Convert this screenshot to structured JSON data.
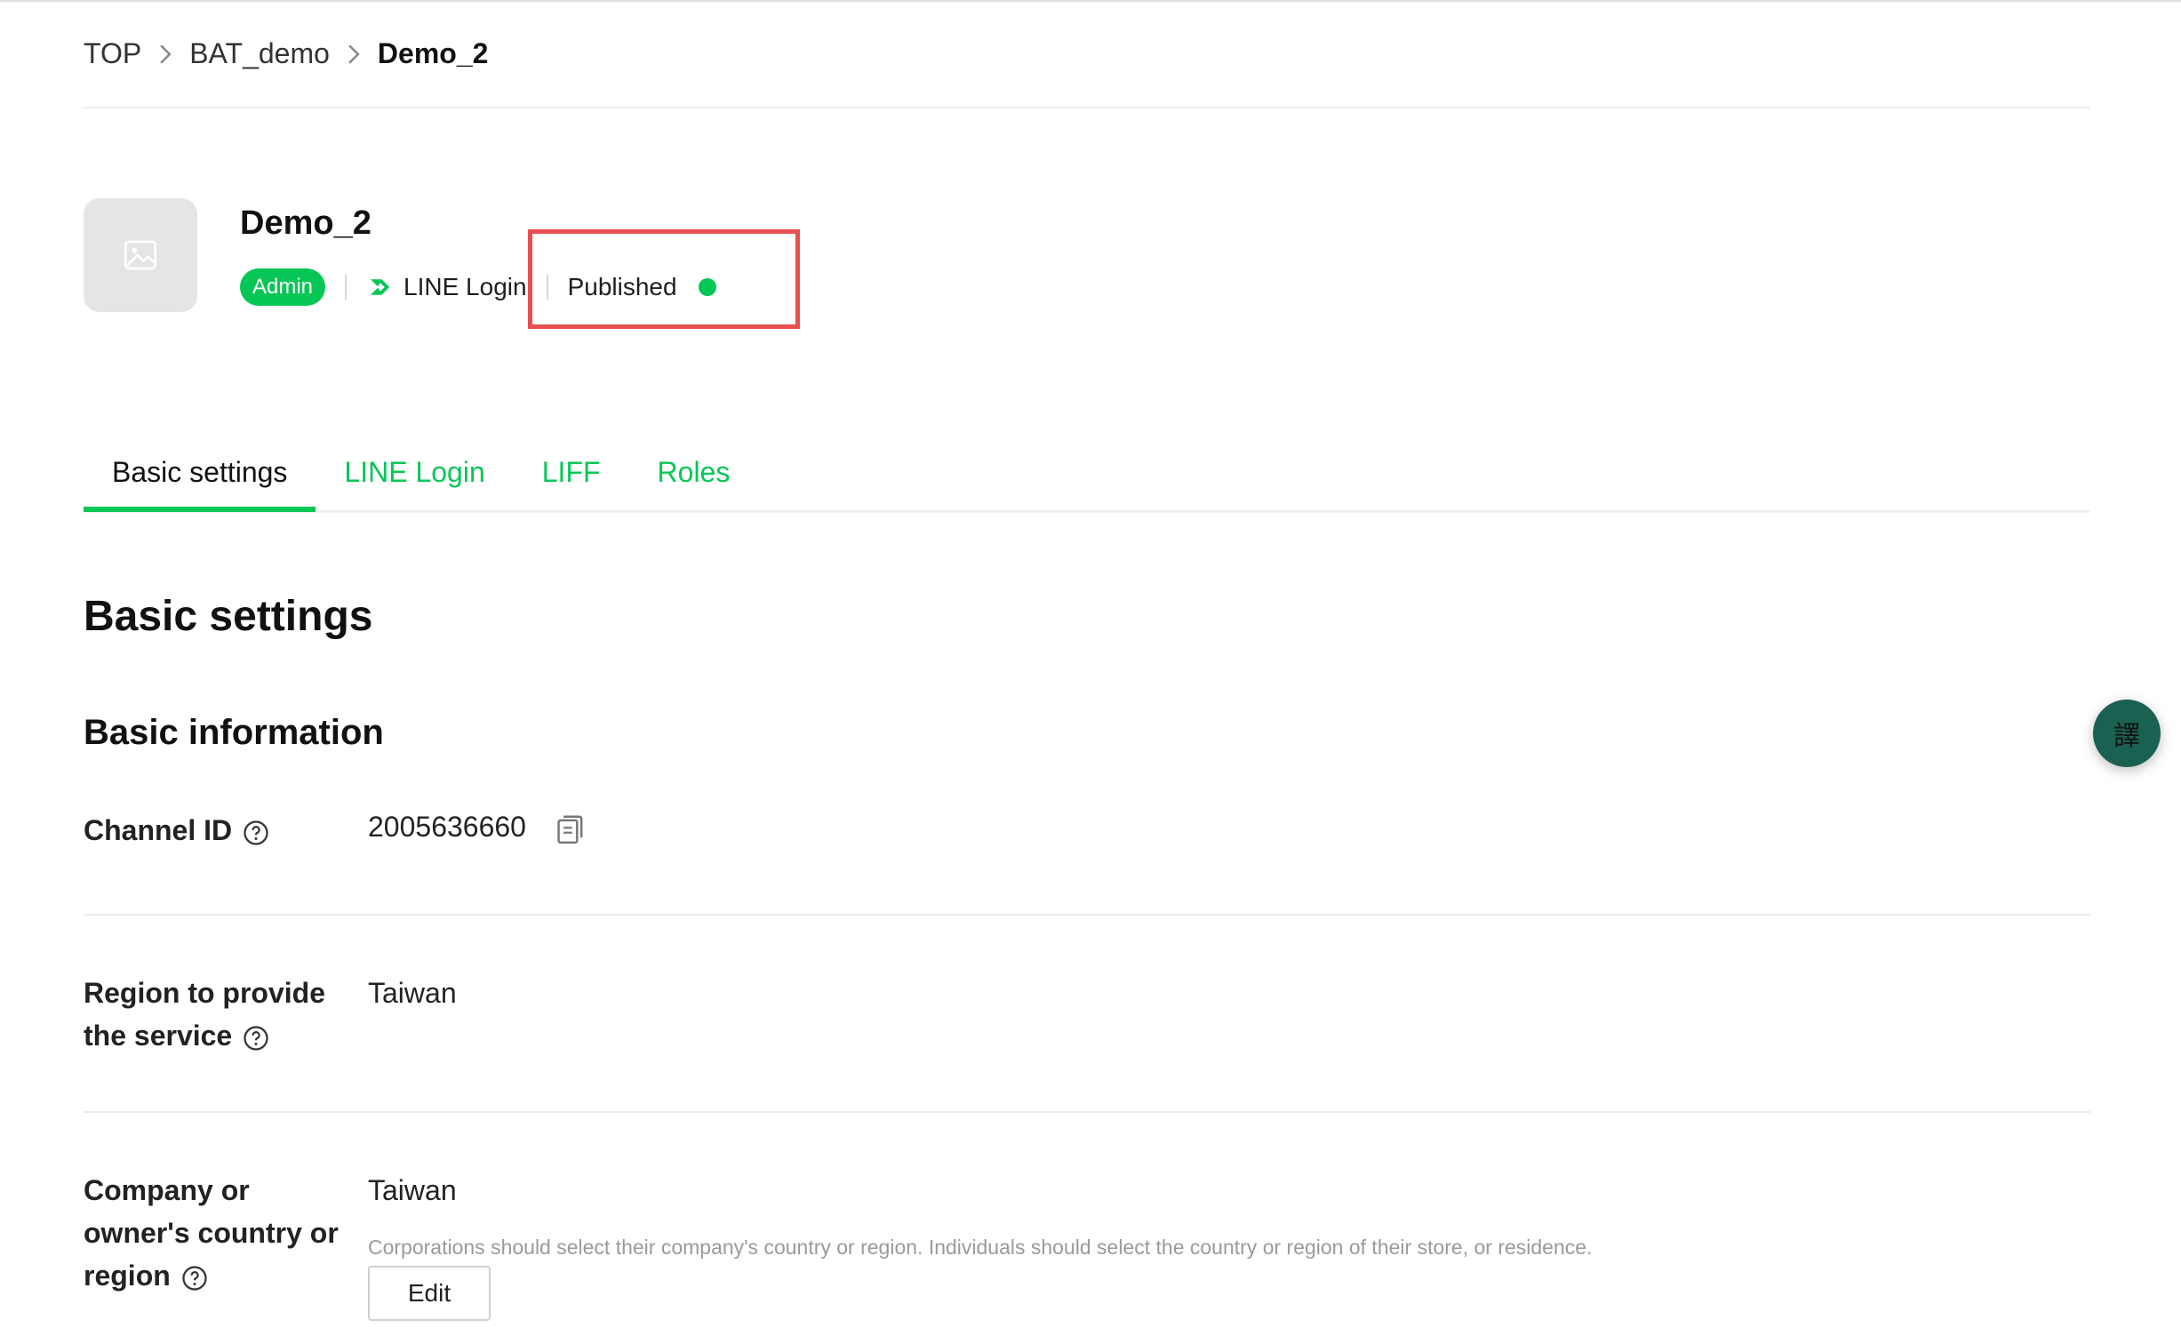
{
  "breadcrumb": {
    "items": [
      "TOP",
      "BAT_demo",
      "Demo_2"
    ]
  },
  "channel": {
    "name": "Demo_2",
    "role_badge": "Admin",
    "type": "LINE Login",
    "status": "Published",
    "status_color": "#06c755"
  },
  "tabs": {
    "items": [
      {
        "label": "Basic settings",
        "active": true
      },
      {
        "label": "LINE Login",
        "active": false
      },
      {
        "label": "LIFF",
        "active": false
      },
      {
        "label": "Roles",
        "active": false
      }
    ]
  },
  "page": {
    "title": "Basic settings",
    "section_title": "Basic information"
  },
  "fields": {
    "channel_id": {
      "label": "Channel ID",
      "value": "2005636660"
    },
    "region": {
      "label_line1": "Region to provide",
      "label_line2": "the service",
      "value": "Taiwan"
    },
    "company_region": {
      "label_line1": "Company or",
      "label_line2": "owner's country or",
      "label_line3": "region",
      "value": "Taiwan",
      "hint": "Corporations should select their company's country or region. Individuals should select the country or region of their store, or residence.",
      "edit_label": "Edit"
    }
  },
  "floating_button": {
    "label": "譯"
  },
  "colors": {
    "accent": "#06c755",
    "highlight": "#e84f4f",
    "fab": "#1a6152"
  }
}
